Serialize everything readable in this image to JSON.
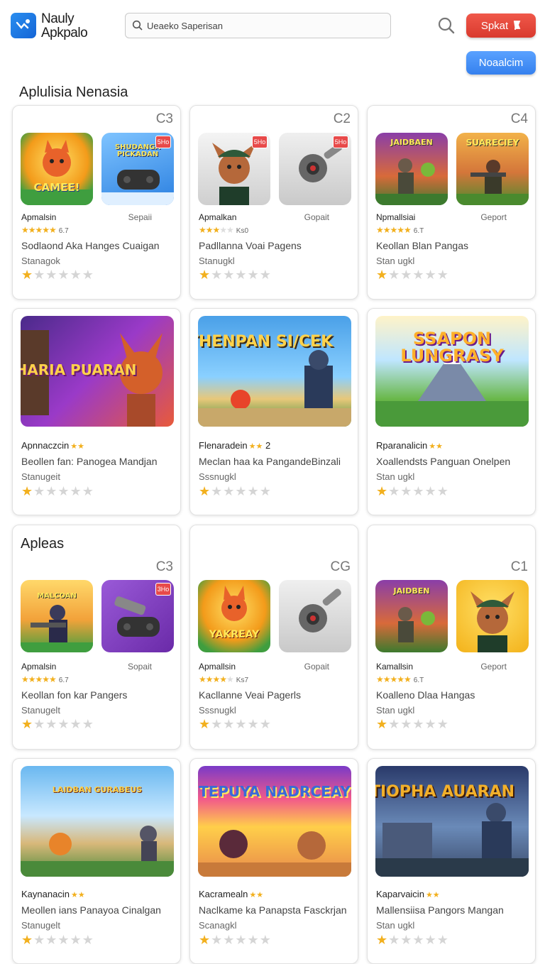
{
  "header": {
    "brand_line1": "Nauly",
    "brand_line2": "Apkpalo",
    "search_placeholder": "Ueaeko Saperisan",
    "red_button": "Spkat",
    "blue_button": "Noaalcim"
  },
  "sections": {
    "s1": "Aplulisia Nenasia",
    "s2": "Apleas"
  },
  "row1": [
    {
      "code": "C3",
      "title": "Apmalsin",
      "publisher": "Sepaii",
      "rating_text": "6.7",
      "desc": "Sodlaond Aka Hanges Cuaigan",
      "sub": "Stanagok",
      "thumb1_text": "CAMEE!",
      "thumb2_text": "SHUDANGA PICKADAN",
      "badge": "5Ho"
    },
    {
      "code": "C2",
      "title": "Apmalkan",
      "publisher": "Gopait",
      "rating_text": "Ks0",
      "desc": "Padllanna Voai Pagens",
      "sub": "Stanugkl",
      "badge1": "5Ho",
      "badge2": "5Ho"
    },
    {
      "code": "C4",
      "title": "Npmallsiai",
      "publisher": "Geport",
      "rating_text": "6.T",
      "desc": "Keollan Blan Pangas",
      "sub": "Stan ugkl",
      "thumb1_text": "JAIDBAEN",
      "thumb2_text": "SUARECIEY"
    }
  ],
  "row2": [
    {
      "name": "Apnnaczcin",
      "desc": "Beollen fan: Panogea Mandjan",
      "sub": "Stanugeit",
      "banner_text": "HARIA PUARAN"
    },
    {
      "name": "Flenaradein",
      "extra": "2",
      "desc": "Meclan haa ka PangandeBinzali",
      "sub": "Sssnugkl",
      "banner_text": "THENPAN SI/CEK"
    },
    {
      "name": "Rparanalicin",
      "desc": "Xoallendsts Panguan Onelpen",
      "sub": "Stan ugkl",
      "banner_text": "SSAPON LUNGRASY"
    }
  ],
  "row3": [
    {
      "code": "C3",
      "title": "Apmalsin",
      "publisher": "Sopait",
      "rating_text": "6.7",
      "desc": "Keollan fon kar Pangers",
      "sub": "Stanugelt",
      "thumb1_text": "MALCOAN",
      "badge": "3Ho"
    },
    {
      "code": "CG",
      "title": "Apmallsin",
      "publisher": "Gopait",
      "rating_text": "Ks7",
      "desc": "Kacllanne Veai Pagerls",
      "sub": "Sssnugkl",
      "thumb1_text": "YAKREAY"
    },
    {
      "code": "C1",
      "title": "Kamallsin",
      "publisher": "Geport",
      "rating_text": "6.T",
      "desc": "Koalleno Dlaa Hangas",
      "sub": "Stan ugkl",
      "thumb1_text": "JAIDBEN"
    }
  ],
  "row4": [
    {
      "name": "Kaynanacin",
      "desc": "Meollen ians Panayoa Cinalgan",
      "sub": "Stanugelt",
      "banner_text": "LAIDBAN GURABEUS"
    },
    {
      "name": "Kacramealn",
      "desc": "Naclkame ka Panapsta Fasckrjan",
      "sub": "Scanagkl",
      "banner_text": "TEPUYA NADRCEAY"
    },
    {
      "name": "Kaparvaicin",
      "desc": "Mallensiisa Pangors Mangan",
      "sub": "Stan ugkl",
      "banner_text": "TIOPHA AUARAN"
    }
  ],
  "colors": {
    "accent_red": "#e2463a",
    "accent_blue": "#4a90f0",
    "star": "#f2b01e"
  }
}
